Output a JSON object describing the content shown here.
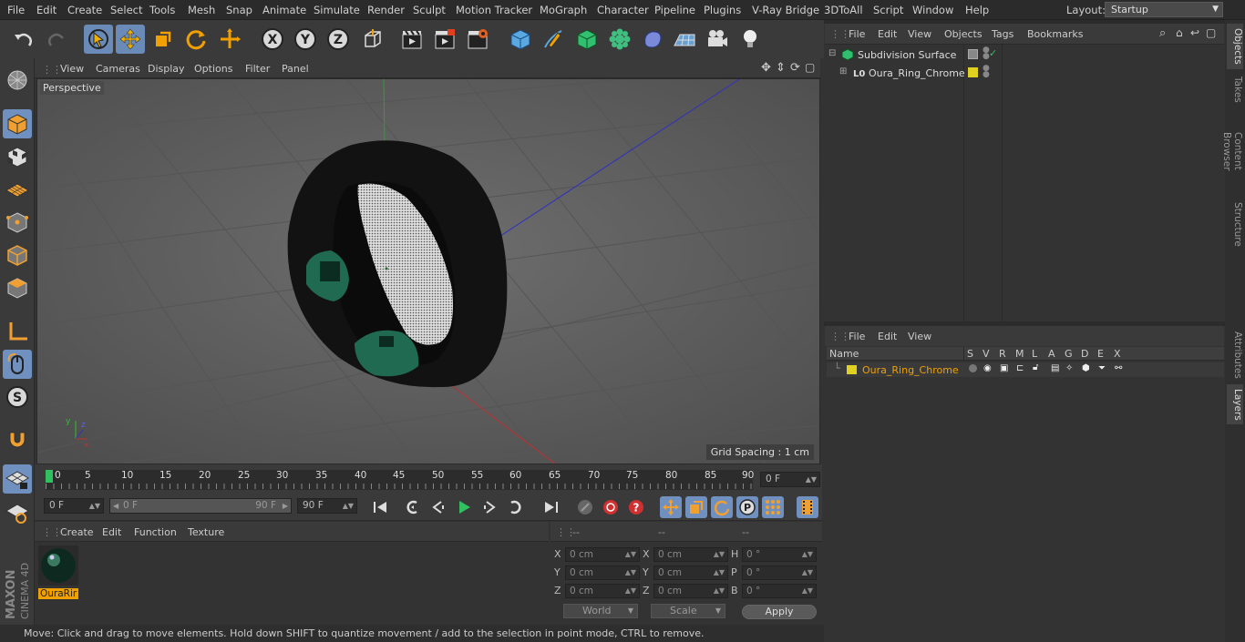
{
  "menubar": {
    "items": [
      "File",
      "Edit",
      "Create",
      "Select",
      "Tools",
      "Mesh",
      "Snap",
      "Animate",
      "Simulate",
      "Render",
      "Sculpt",
      "Motion Tracker",
      "MoGraph",
      "Character",
      "Pipeline",
      "Plugins",
      "V-Ray Bridge",
      "3DToAll",
      "Script",
      "Window",
      "Help"
    ],
    "layout_label": "Layout:",
    "layout_value": "Startup"
  },
  "viewport": {
    "menu": [
      "View",
      "Cameras",
      "Display",
      "Options",
      "Filter",
      "Panel"
    ],
    "camera_label": "Perspective",
    "grid_spacing": "Grid Spacing : 1 cm"
  },
  "timeline": {
    "ticks": [
      "0",
      "5",
      "10",
      "15",
      "20",
      "25",
      "30",
      "35",
      "40",
      "45",
      "50",
      "55",
      "60",
      "65",
      "70",
      "75",
      "80",
      "85",
      "90"
    ],
    "current_frame": "0 F"
  },
  "transport": {
    "start_field": "0 F",
    "range_start": "0 F",
    "range_end": "90 F",
    "end_field": "90 F"
  },
  "material_manager": {
    "menu": [
      "Create",
      "Edit",
      "Function",
      "Texture"
    ],
    "material_name": "OuraRir"
  },
  "coordinates": {
    "headers": [
      "--",
      "--",
      "--"
    ],
    "rows": [
      {
        "l1": "X",
        "v1": "0 cm",
        "l2": "X",
        "v2": "0 cm",
        "l3": "H",
        "v3": "0 °"
      },
      {
        "l1": "Y",
        "v1": "0 cm",
        "l2": "Y",
        "v2": "0 cm",
        "l3": "P",
        "v3": "0 °"
      },
      {
        "l1": "Z",
        "v1": "0 cm",
        "l2": "Z",
        "v2": "0 cm",
        "l3": "B",
        "v3": "0 °"
      }
    ],
    "world_label": "World",
    "scale_label": "Scale",
    "apply_label": "Apply"
  },
  "status": "Move: Click and drag to move elements. Hold down SHIFT to quantize movement / add to the selection in point mode, CTRL to remove.",
  "object_manager": {
    "menu": [
      "File",
      "Edit",
      "View",
      "Objects",
      "Tags",
      "Bookmarks"
    ],
    "objects": [
      {
        "name": "Subdivision Surface"
      },
      {
        "name": "Oura_Ring_Chrome"
      }
    ]
  },
  "layers_manager": {
    "menu": [
      "File",
      "Edit",
      "View"
    ],
    "header": {
      "name": "Name",
      "cols": [
        "S",
        "V",
        "R",
        "M",
        "L",
        "A",
        "G",
        "D",
        "E",
        "X"
      ]
    },
    "rows": [
      {
        "name": "Oura_Ring_Chrome"
      }
    ]
  },
  "right_tabs": [
    "Objects",
    "Takes",
    "Content Browser",
    "Structure",
    "Attributes",
    "Layers"
  ],
  "brand": {
    "line1": "MAXON",
    "line2": "CINEMA 4D"
  },
  "colors": {
    "accent": "#7090c0",
    "selected_text": "#f0a000",
    "layer_color": "#e0d020"
  }
}
